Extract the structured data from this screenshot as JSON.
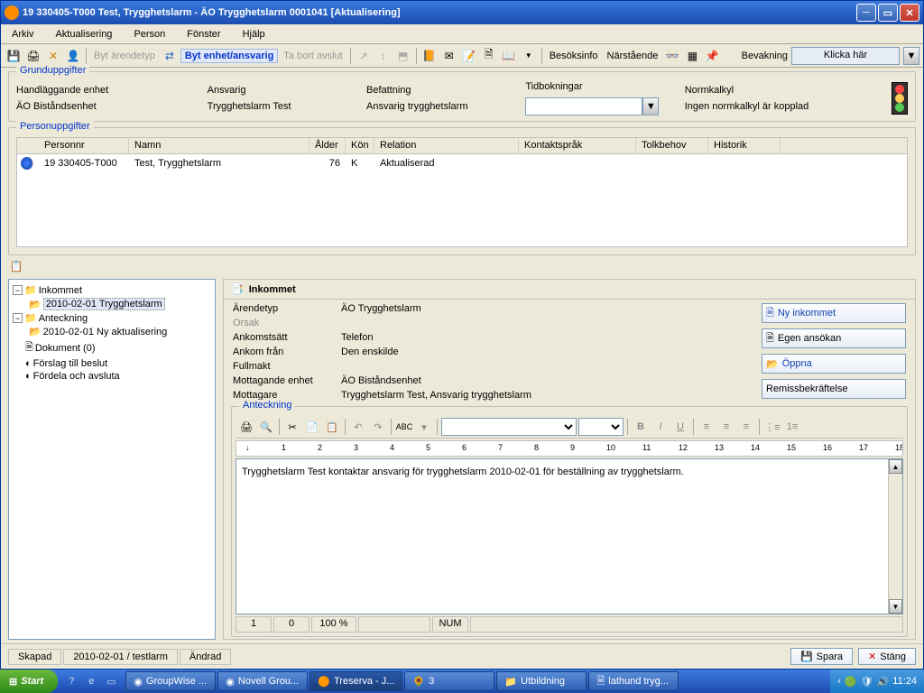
{
  "window": {
    "title": "19 330405-T000   Test, Trygghetslarm   -   ÄO Trygghetslarm   0001041   [Aktualisering]"
  },
  "menu": {
    "arkiv": "Arkiv",
    "aktualisering": "Aktualisering",
    "person": "Person",
    "fonster": "Fönster",
    "hjalp": "Hjälp"
  },
  "toolbar": {
    "byt_arendetyp": "Byt ärendetyp",
    "byt_enhet": "Byt enhet/ansvarig",
    "ta_bort": "Ta bort avslut",
    "besoksinfo": "Besöksinfo",
    "narstaende": "Närstående",
    "bevakning": "Bevakning",
    "klicka": "Klicka här"
  },
  "grund": {
    "legend": "Grunduppgifter",
    "handl_label": "Handläggande enhet",
    "handl_val": "ÄO Biståndsenhet",
    "ansvarig_label": "Ansvarig",
    "ansvarig_val": "Trygghetslarm Test",
    "befattning_label": "Befattning",
    "befattning_val": "Ansvarig trygghetslarm",
    "tid_label": "Tidbokningar",
    "norm_label": "Normkalkyl",
    "norm_val": "Ingen normkalkyl är kopplad"
  },
  "person": {
    "legend": "Personuppgifter",
    "headers": {
      "personnr": "Personnr",
      "namn": "Namn",
      "alder": "Ålder",
      "kon": "Kön",
      "relation": "Relation",
      "kontakt": "Kontaktspråk",
      "tolk": "Tolkbehov",
      "historik": "Historik"
    },
    "row": {
      "personnr": "19 330405-T000",
      "namn": "Test, Trygghetslarm",
      "alder": "76",
      "kon": "K",
      "relation": "Aktualiserad"
    }
  },
  "tree": {
    "inkommet": "Inkommet",
    "inkommet_item": "2010-02-01 Trygghetslarm",
    "anteckning": "Anteckning",
    "anteckning_item": "2010-02-01 Ny aktualisering",
    "dokument": "Dokument (0)",
    "forslag": "Förslag till beslut",
    "fordela": "Fördela och avsluta"
  },
  "panel": {
    "title": "Inkommet",
    "fields": {
      "arendetyp_l": "Ärendetyp",
      "arendetyp_v": "ÄO Trygghetslarm",
      "orsak_l": "Orsak",
      "orsak_v": "",
      "ankomst_l": "Ankomstsätt",
      "ankomst_v": "Telefon",
      "ankomfran_l": "Ankom från",
      "ankomfran_v": "Den enskilde",
      "fullmakt_l": "Fullmakt",
      "fullmakt_v": "",
      "mottag_l": "Mottagande enhet",
      "mottag_v": "ÄO Biståndsenhet",
      "mottagare_l": "Mottagare",
      "mottagare_v": "Trygghetslarm Test, Ansvarig trygghetslarm"
    },
    "buttons": {
      "ny": "Ny inkommet",
      "egen": "Egen ansökan",
      "oppna": "Öppna",
      "remiss": "Remissbekräftelse"
    }
  },
  "anteck": {
    "legend": "Anteckning",
    "text": "Trygghetslarm Test kontaktar ansvarig för trygghetslarm 2010-02-01 för beställning av trygghetslarm.",
    "status": {
      "line": "1",
      "col": "0",
      "zoom": "100 %",
      "num": "NUM"
    }
  },
  "footer": {
    "skapad": "Skapad",
    "skapad_v": "2010-02-01 / testlarm",
    "andrad": "Ändrad",
    "spara": "Spara",
    "stang": "Stäng"
  },
  "taskbar": {
    "start": "Start",
    "tasks": [
      "GroupWise ...",
      "Novell Grou...",
      "Treserva - J...",
      "3",
      "Utbildning",
      "lathund tryg..."
    ],
    "time": "11:24"
  }
}
